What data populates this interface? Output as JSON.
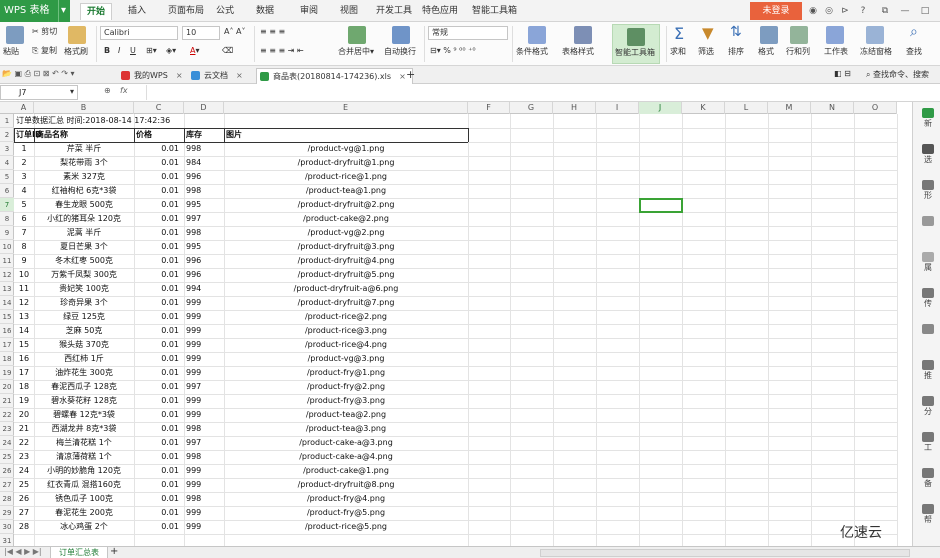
{
  "app": {
    "logo": "WPS 表格",
    "login": "未登录"
  },
  "menu": {
    "tabs": [
      "开始",
      "插入",
      "页面布局",
      "公式",
      "数据",
      "审阅",
      "视图",
      "开发工具",
      "特色应用",
      "智能工具箱"
    ],
    "active": 0
  },
  "toolbar": {
    "paste": "粘贴",
    "cut": "剪切",
    "copy": "复制",
    "format_painter": "格式刷",
    "font": "Calibri",
    "font_size": "10",
    "bold": "B",
    "italic": "I",
    "underline": "U",
    "merge": "合并居中",
    "wrap": "自动换行",
    "number_format": "常规",
    "percent": "%",
    "conditional": "条件格式",
    "table_style": "表格样式",
    "smart_tools": "智能工具箱",
    "sum": "求和",
    "filter": "筛选",
    "sort": "排序",
    "format": "格式",
    "row_col": "行和列",
    "worksheet": "工作表",
    "freeze": "冻结窗格",
    "find": "查找"
  },
  "doc_tabs": [
    {
      "label": "我的WPS"
    },
    {
      "label": "云文档"
    },
    {
      "label": "商品表(20180814-174236).xls"
    }
  ],
  "formula": {
    "cell_ref": "J7",
    "fx": "fx",
    "search": "查找命令、搜索"
  },
  "columns": [
    "A",
    "B",
    "C",
    "D",
    "E",
    "F",
    "G",
    "H",
    "I",
    "J",
    "K",
    "L",
    "M",
    "N",
    "O"
  ],
  "sheet": {
    "title": "订单数据汇总 时间:2018-08-14 17:42:36",
    "headers": [
      "订单ID",
      "商品名称",
      "价格",
      "库存",
      "图片"
    ],
    "rows": [
      [
        "1",
        "芹菜 半斤",
        "0.01",
        "998",
        "/product-vg@1.png"
      ],
      [
        "2",
        "梨花带雨 3个",
        "0.01",
        "984",
        "/product-dryfruit@1.png"
      ],
      [
        "3",
        "素米 327克",
        "0.01",
        "996",
        "/product-rice@1.png"
      ],
      [
        "4",
        "红袖枸杞 6克*3袋",
        "0.01",
        "998",
        "/product-tea@1.png"
      ],
      [
        "5",
        "春生龙眼 500克",
        "0.01",
        "995",
        "/product-dryfruit@2.png"
      ],
      [
        "6",
        "小红的猪耳朵 120克",
        "0.01",
        "997",
        "/product-cake@2.png"
      ],
      [
        "7",
        "泥蒿 半斤",
        "0.01",
        "998",
        "/product-vg@2.png"
      ],
      [
        "8",
        "夏日芒果 3个",
        "0.01",
        "995",
        "/product-dryfruit@3.png"
      ],
      [
        "9",
        "冬木红枣 500克",
        "0.01",
        "996",
        "/product-dryfruit@4.png"
      ],
      [
        "10",
        "万紫千凤梨 300克",
        "0.01",
        "996",
        "/product-dryfruit@5.png"
      ],
      [
        "11",
        "贵妃笑 100克",
        "0.01",
        "994",
        "/product-dryfruit-a@6.png"
      ],
      [
        "12",
        "珍奇异果 3个",
        "0.01",
        "999",
        "/product-dryfruit@7.png"
      ],
      [
        "13",
        "绿豆 125克",
        "0.01",
        "999",
        "/product-rice@2.png"
      ],
      [
        "14",
        "芝麻 50克",
        "0.01",
        "999",
        "/product-rice@3.png"
      ],
      [
        "15",
        "猴头菇 370克",
        "0.01",
        "999",
        "/product-rice@4.png"
      ],
      [
        "16",
        "西红柿 1斤",
        "0.01",
        "999",
        "/product-vg@3.png"
      ],
      [
        "17",
        "油炸花生 300克",
        "0.01",
        "999",
        "/product-fry@1.png"
      ],
      [
        "18",
        "春泥西瓜子 128克",
        "0.01",
        "997",
        "/product-fry@2.png"
      ],
      [
        "19",
        "碧水葵花籽 128克",
        "0.01",
        "999",
        "/product-fry@3.png"
      ],
      [
        "20",
        "碧螺春 12克*3袋",
        "0.01",
        "999",
        "/product-tea@2.png"
      ],
      [
        "21",
        "西湖龙井 8克*3袋",
        "0.01",
        "998",
        "/product-tea@3.png"
      ],
      [
        "22",
        "梅兰清花糕 1个",
        "0.01",
        "997",
        "/product-cake-a@3.png"
      ],
      [
        "23",
        "清凉薄荷糕 1个",
        "0.01",
        "998",
        "/product-cake-a@4.png"
      ],
      [
        "24",
        "小明的妙脆角 120克",
        "0.01",
        "999",
        "/product-cake@1.png"
      ],
      [
        "25",
        "红衣青瓜 混搭160克",
        "0.01",
        "999",
        "/product-dryfruit@8.png"
      ],
      [
        "26",
        "锈色瓜子 100克",
        "0.01",
        "998",
        "/product-fry@4.png"
      ],
      [
        "27",
        "春泥花生 200克",
        "0.01",
        "999",
        "/product-fry@5.png"
      ],
      [
        "28",
        "冰心鸡蛋 2个",
        "0.01",
        "999",
        "/product-rice@5.png"
      ]
    ]
  },
  "right_panel": [
    "新",
    "选",
    "形",
    "",
    "属",
    "传",
    "",
    "推",
    "分",
    "工",
    "备",
    "帮"
  ],
  "bottom": {
    "sheet_tab": "订单汇总表",
    "add": "+"
  },
  "watermark": "亿速云",
  "colors": {
    "accent": "#2f9a46",
    "login": "#e9623c",
    "selection": "#3aa335"
  }
}
